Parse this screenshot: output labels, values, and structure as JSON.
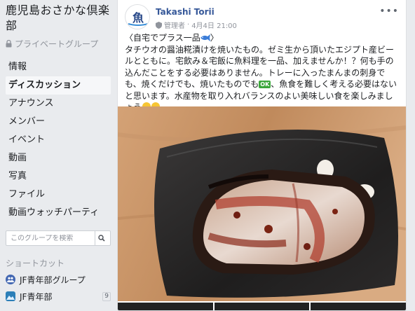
{
  "group": {
    "title": "鹿児島おさかな倶楽部",
    "privacy_label": "プライベートグループ"
  },
  "nav": {
    "items": [
      {
        "label": "情報"
      },
      {
        "label": "ディスカッション"
      },
      {
        "label": "アナウンス"
      },
      {
        "label": "メンバー"
      },
      {
        "label": "イベント"
      },
      {
        "label": "動画"
      },
      {
        "label": "写真"
      },
      {
        "label": "ファイル"
      },
      {
        "label": "動画ウォッチパーティ"
      }
    ]
  },
  "search": {
    "placeholder": "このグループを検索"
  },
  "shortcuts": {
    "title": "ショートカット",
    "items": [
      {
        "label": "JF青年部グループ",
        "badge": ""
      },
      {
        "label": "JF青年部",
        "badge": "9"
      }
    ]
  },
  "post": {
    "author": "Takashi Torii",
    "role": "管理者",
    "date": "4月4日 21:00",
    "avatar_text": "魚",
    "line1": "〈自宅でプラス一品",
    "body_a": "タチウオの醤油糀漬けを焼いたもの。ゼミ生から頂いたエジプト産ビールとともに。宅飲み＆宅飯に魚料理を一品、加えませんか！？何も手の込んだことをする必要はありません。トレーに入ったまんまの刺身でも、焼くだけでも、焼いたものでも",
    "ok_label": "OK",
    "body_b": "、魚食を難しく考える必要はないと思います。水産物を取り入れバランスのよい美味しい食を楽しみましょう"
  },
  "colors": {
    "link": "#365899",
    "background": "#e9ebee",
    "meta": "#90949c"
  }
}
